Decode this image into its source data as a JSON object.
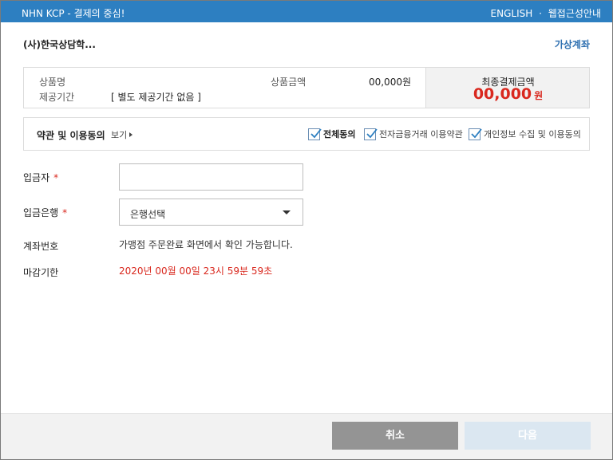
{
  "titlebar": {
    "brand": "NHN KCP - 결제의 중심!",
    "lang": "ENGLISH",
    "separator": "·",
    "accessibility": "웹접근성안내"
  },
  "merchant_name": "(사)한국상담학...",
  "payment_method": "가상계좌",
  "summary": {
    "product_label": "상품명",
    "period_label": "제공기간",
    "period_value": "[ 별도 제공기간 없음 ]",
    "amount_label": "상품금액",
    "amount_value": "00,000원",
    "total_label": "최종결제금액",
    "total_amount": "00,000",
    "total_unit": "원"
  },
  "terms": {
    "title": "약관 및 이용동의",
    "view_label": "보기",
    "agree_all": "전체동의",
    "agree_efinance": "전자금융거래 이용약관",
    "agree_privacy": "개인정보 수집 및 이용동의"
  },
  "form": {
    "depositor_label": "입금자",
    "depositor_value": "",
    "bank_label": "입금은행",
    "bank_selected": "은행선택",
    "account_label": "계좌번호",
    "account_value": "가맹점 주문완료 화면에서 확인 가능합니다.",
    "deadline_label": "마감기한",
    "deadline_value": "2020년 00월 00일 23시 59분 59초",
    "required_mark": "*"
  },
  "footer": {
    "cancel_label": "취소",
    "next_label": "다음"
  },
  "colors": {
    "primary": "#2d7fc1",
    "accent_red": "#d9281e",
    "cancel_btn": "#949494",
    "next_btn_disabled": "#dbe7f1"
  }
}
